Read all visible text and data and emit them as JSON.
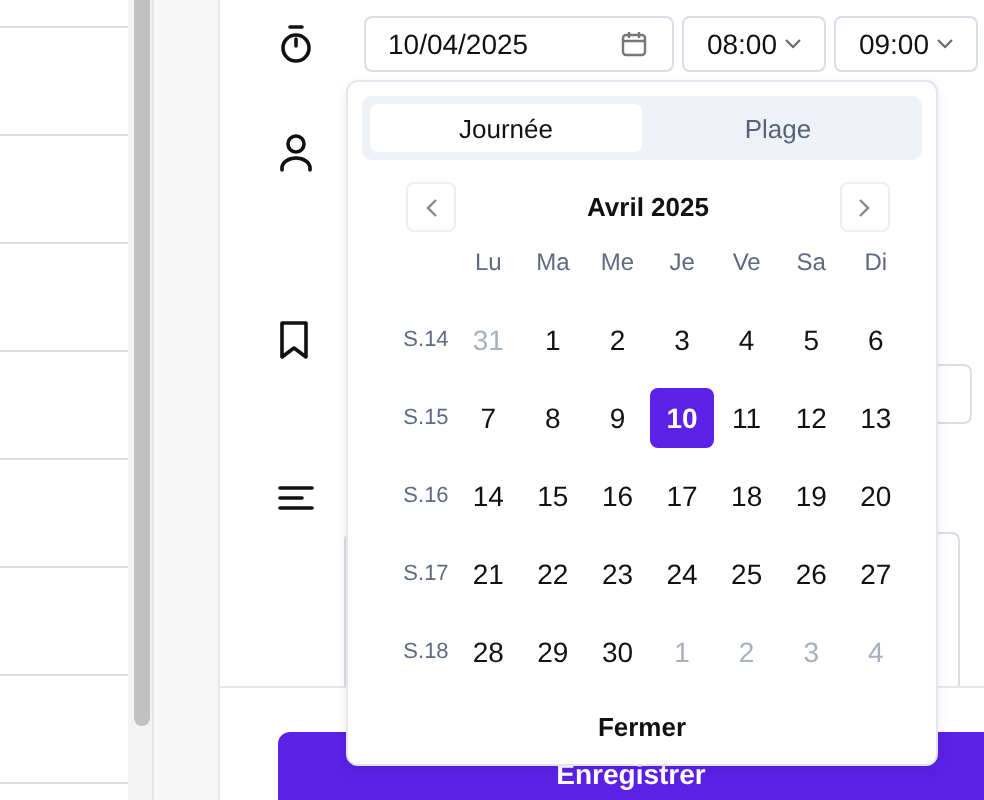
{
  "date_field": {
    "value": "10/04/2025"
  },
  "start_time": {
    "value": "08:00"
  },
  "end_time": {
    "value": "09:00"
  },
  "picker": {
    "modes": [
      {
        "label": "Journée",
        "selected": true
      },
      {
        "label": "Plage",
        "selected": false
      }
    ],
    "month": "Avril 2025",
    "weekdays": [
      "Lu",
      "Ma",
      "Me",
      "Je",
      "Ve",
      "Sa",
      "Di"
    ],
    "weeks": [
      {
        "label": "S.14",
        "days": [
          {
            "text": "31",
            "muted": true,
            "selected": false
          },
          {
            "text": "1",
            "muted": false,
            "selected": false
          },
          {
            "text": "2",
            "muted": false,
            "selected": false
          },
          {
            "text": "3",
            "muted": false,
            "selected": false
          },
          {
            "text": "4",
            "muted": false,
            "selected": false
          },
          {
            "text": "5",
            "muted": false,
            "selected": false
          },
          {
            "text": "6",
            "muted": false,
            "selected": false
          }
        ]
      },
      {
        "label": "S.15",
        "days": [
          {
            "text": "7",
            "muted": false,
            "selected": false
          },
          {
            "text": "8",
            "muted": false,
            "selected": false
          },
          {
            "text": "9",
            "muted": false,
            "selected": false
          },
          {
            "text": "10",
            "muted": false,
            "selected": true
          },
          {
            "text": "11",
            "muted": false,
            "selected": false
          },
          {
            "text": "12",
            "muted": false,
            "selected": false
          },
          {
            "text": "13",
            "muted": false,
            "selected": false
          }
        ]
      },
      {
        "label": "S.16",
        "days": [
          {
            "text": "14",
            "muted": false,
            "selected": false
          },
          {
            "text": "15",
            "muted": false,
            "selected": false
          },
          {
            "text": "16",
            "muted": false,
            "selected": false
          },
          {
            "text": "17",
            "muted": false,
            "selected": false
          },
          {
            "text": "18",
            "muted": false,
            "selected": false
          },
          {
            "text": "19",
            "muted": false,
            "selected": false
          },
          {
            "text": "20",
            "muted": false,
            "selected": false
          }
        ]
      },
      {
        "label": "S.17",
        "days": [
          {
            "text": "21",
            "muted": false,
            "selected": false
          },
          {
            "text": "22",
            "muted": false,
            "selected": false
          },
          {
            "text": "23",
            "muted": false,
            "selected": false
          },
          {
            "text": "24",
            "muted": false,
            "selected": false
          },
          {
            "text": "25",
            "muted": false,
            "selected": false
          },
          {
            "text": "26",
            "muted": false,
            "selected": false
          },
          {
            "text": "27",
            "muted": false,
            "selected": false
          }
        ]
      },
      {
        "label": "S.18",
        "days": [
          {
            "text": "28",
            "muted": false,
            "selected": false
          },
          {
            "text": "29",
            "muted": false,
            "selected": false
          },
          {
            "text": "30",
            "muted": false,
            "selected": false
          },
          {
            "text": "1",
            "muted": true,
            "selected": false
          },
          {
            "text": "2",
            "muted": true,
            "selected": false
          },
          {
            "text": "3",
            "muted": true,
            "selected": false
          },
          {
            "text": "4",
            "muted": true,
            "selected": false
          }
        ]
      }
    ],
    "close_button": "Fermer"
  },
  "save_button": "Enregistrer"
}
